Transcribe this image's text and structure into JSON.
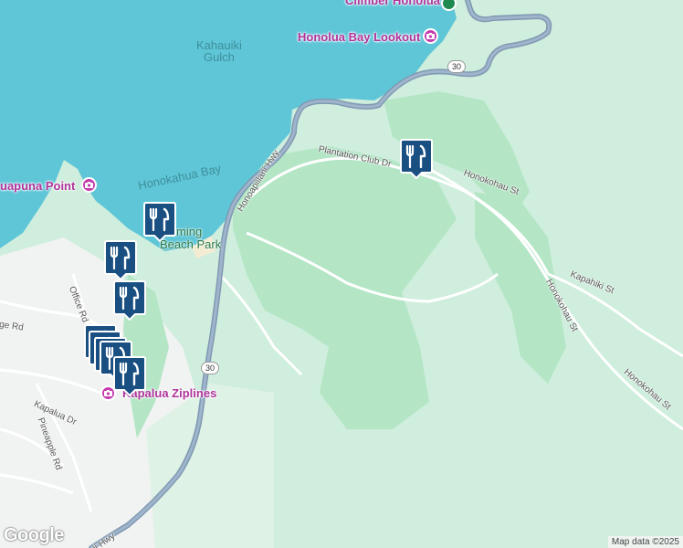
{
  "map": {
    "water_labels": [
      "Kahauiki\nGulch",
      "Honokahua Bay"
    ],
    "poi_labels": [
      "Honolua Bay Lookout",
      "uapuna Point",
      "Kapalua Ziplines"
    ],
    "poi_top_cut": "Climber Honolua",
    "park_label": [
      "Fleming",
      "Beach Park"
    ],
    "road_labels": {
      "hwy_main": "Honoapiilani Hwy",
      "hwy_bottom": "ii Hwy",
      "plantation": "Plantation Club Dr",
      "honokohau_a": "Honokohau St",
      "honokohau_b": "Honokohau St",
      "honokohau_c": "Honokohau St",
      "kapahiki": "Kapahiki St",
      "office": "Office Rd",
      "kapalua_dr": "Kapalua Dr",
      "pineapple": "Pineapple Rd",
      "ridge": "ge Rd"
    },
    "route_shield": "30",
    "marker_icon": "restaurant-icon",
    "colors": {
      "water": "#5fc6d8",
      "land": "#cfeedd",
      "golf": "#b4e6c6",
      "road": "#7f99b3",
      "marker_fill": "#1a4f82",
      "poi": "#c63bac"
    }
  },
  "branding": {
    "logo": "Google",
    "attribution": "Map data ©2025"
  }
}
